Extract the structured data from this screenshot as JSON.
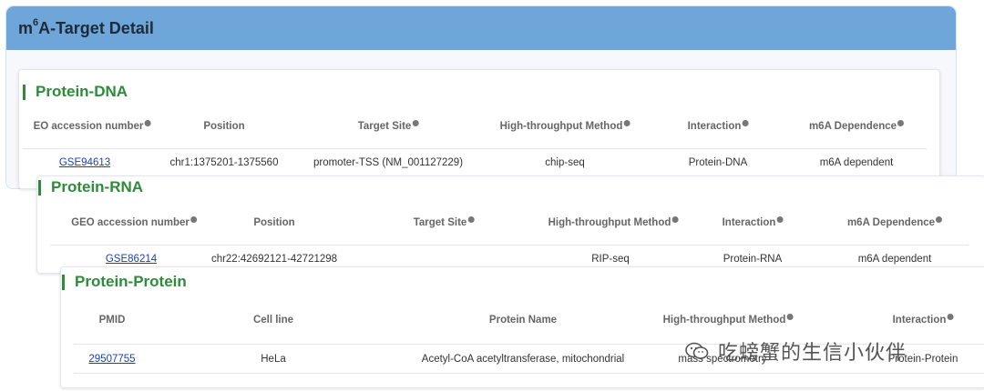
{
  "header": {
    "title_prefix": "m",
    "title_sup": "6",
    "title_rest": "A-Target Detail"
  },
  "protein_dna": {
    "title": "Protein-DNA",
    "columns": [
      "EO accession number",
      "Position",
      "Target Site",
      "High-throughput Method",
      "Interaction",
      "m6A Dependence"
    ],
    "row": {
      "accession": "GSE94613",
      "position": "chr1:1375201-1375560",
      "target_site": "promoter-TSS (NM_001127229)",
      "method": "chip-seq",
      "interaction": "Protein-DNA",
      "dependence": "m6A dependent"
    }
  },
  "protein_rna": {
    "title": "Protein-RNA",
    "columns": [
      "GEO accession number",
      "Position",
      "Target Site",
      "High-throughput Method",
      "Interaction",
      "m6A Dependence"
    ],
    "row": {
      "accession": "GSE86214",
      "position": "chr22:42692121-42721298",
      "method": "RIP-seq",
      "interaction": "Protein-RNA",
      "dependence": "m6A dependent"
    }
  },
  "protein_protein": {
    "title": "Protein-Protein",
    "columns": [
      "PMID",
      "Cell line",
      "Protein Name",
      "High-throughput Method",
      "Interaction"
    ],
    "row": {
      "pmid": "29507755",
      "cell_line": "HeLa",
      "protein_name": "Acetyl-CoA acetyltransferase, mitochondrial",
      "method": "mass spectrometry",
      "interaction": "Protein-Protein"
    }
  },
  "watermark": {
    "text": "吃螃蟹的生信小伙伴",
    "icon": "wechat-icon"
  },
  "colors": {
    "header_bg": "#6fa6da",
    "title_green": "#2e8b3a",
    "link": "#1a3fb3"
  }
}
